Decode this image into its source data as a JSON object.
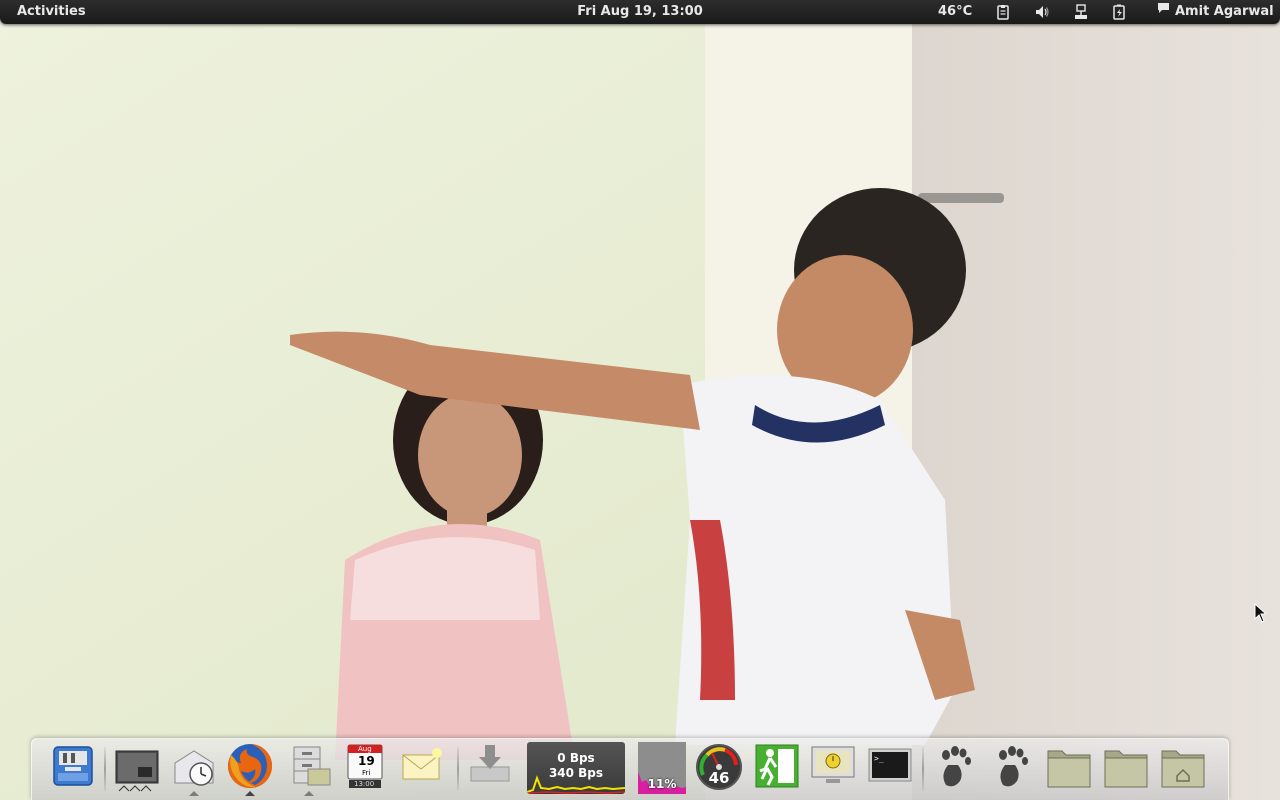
{
  "top_panel": {
    "activities_label": "Activities",
    "clock": "Fri Aug 19, 13:00",
    "temperature": "46°C",
    "tray_icons": [
      "clipboard-icon",
      "volume-icon",
      "network-icon",
      "battery-icon"
    ],
    "user_name": "Amit Agarwal"
  },
  "dock": {
    "items": [
      "system-settings-icon",
      "workspace-switcher-icon",
      "time-sync-icon",
      "firefox-icon",
      "file-cabinet-icon",
      "calendar-icon",
      "mail-icon",
      "downloads-icon",
      "network-monitor",
      "cpu-monitor",
      "temperature-gauge",
      "exit-icon",
      "screensaver-icon",
      "terminal-icon",
      "gnome-foot-icon",
      "gnome-foot-icon",
      "folder-icon",
      "folder-icon",
      "home-folder-icon"
    ],
    "calendar": {
      "month": "Aug",
      "day": "19",
      "weekday": "Fri",
      "time": "13:00"
    },
    "network_monitor": {
      "upload": "0 Bps",
      "download": "340 Bps"
    },
    "cpu_monitor": {
      "value": "11%",
      "level": 0.11
    },
    "temperature_gauge": {
      "value": "46"
    }
  },
  "colors": {
    "panel_bg": "#1f1f1f",
    "panel_text": "#e8e8e8",
    "net_graph_yellow": "#f2e400",
    "net_graph_red": "#e02020",
    "cpu_graph_magenta": "#d81fa0"
  }
}
